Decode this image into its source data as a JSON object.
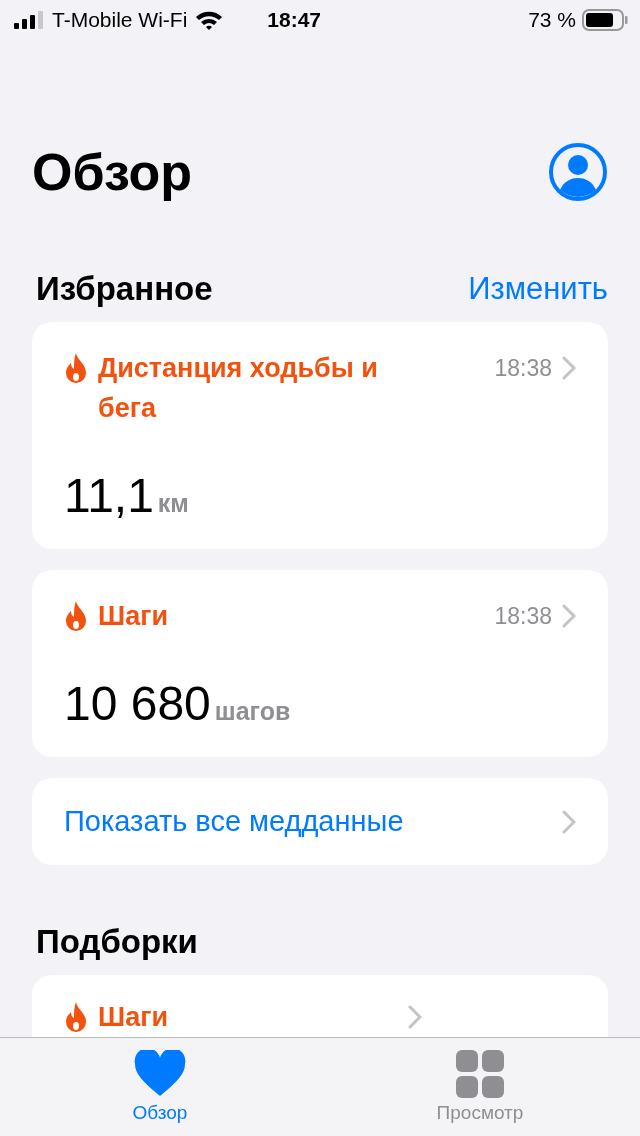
{
  "status_bar": {
    "carrier": "T-Mobile Wi-Fi",
    "time": "18:47",
    "battery": "73 %"
  },
  "title": "Обзор",
  "favorites": {
    "title": "Избранное",
    "edit": "Изменить",
    "cards": [
      {
        "title": "Дистанция ходьбы и бега",
        "time": "18:38",
        "value": "11,1",
        "unit": "км"
      },
      {
        "title": "Шаги",
        "time": "18:38",
        "value": "10 680",
        "unit": "шагов"
      }
    ],
    "show_all": "Показать все медданные"
  },
  "highlights": {
    "title": "Подборки",
    "cards": [
      {
        "title": "Шаги"
      }
    ]
  },
  "tabs": [
    {
      "label": "Обзор",
      "selected": true
    },
    {
      "label": "Просмотр",
      "selected": false
    }
  ]
}
